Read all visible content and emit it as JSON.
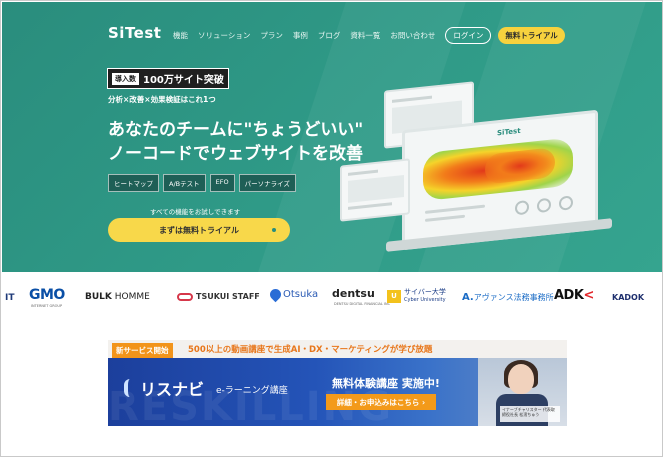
{
  "header": {
    "logo": "SiTest",
    "nav": [
      "機能",
      "ソリューション",
      "プラン",
      "事例",
      "ブログ",
      "資料一覧",
      "お問い合わせ"
    ],
    "login": "ログイン",
    "trial": "無料トライアル"
  },
  "hero": {
    "badge_tag": "導入数",
    "badge_text": "100万サイト突破",
    "tagline": "分析×改善×効果検証はこれ1つ",
    "headline_1": "あなたのチームに\"ちょうどいい\"",
    "headline_2": "ノーコードでウェブサイトを改善",
    "tags": [
      "ヒートマップ",
      "A/Bテスト",
      "EFO",
      "パーソナライズ"
    ],
    "cta_note": "すべての機能をお試しできます",
    "cta_label": "まずは無料トライアル",
    "mockup_logo": "SiTest"
  },
  "logos": {
    "it": "IT",
    "gmo": "GMO",
    "gmo_sub": "INTERNET GROUP",
    "bulk_bold": "BULK",
    "bulk_rest": " HOMME",
    "tsukui": "TSUKUI STAFF",
    "otsuka": "Otsuka",
    "dentsu": "dentsu",
    "dentsu_sub": "DENTSU DIGITAL FINANCIAL INC",
    "cyber_mark": "U",
    "cyber_1": "サイバー大学",
    "cyber_2": "Cyber University",
    "avance_mark": "A.",
    "avance": "アヴァンス法務事務所",
    "adk": "ADK",
    "adk_k": "<",
    "kadok": "KADOK"
  },
  "banner": {
    "badge": "新サービス開始",
    "headline": "500以上の動画講座で生成AI・DX・マーケティングが学び放題",
    "brand": "リスナビ",
    "sub": "e-ラーニング講座",
    "promo": "無料体験講座 実施中!",
    "button": "詳細・お申込みはこちら ›",
    "watermark": "RESKILLING",
    "caption": "イナーブチャリスター 代表取締役社長 松濱ちゅう"
  },
  "colors": {
    "brand_green": "#2f9a87",
    "accent_yellow": "#f8d84a",
    "banner_blue": "#2454b8",
    "banner_orange": "#f39a1a"
  }
}
